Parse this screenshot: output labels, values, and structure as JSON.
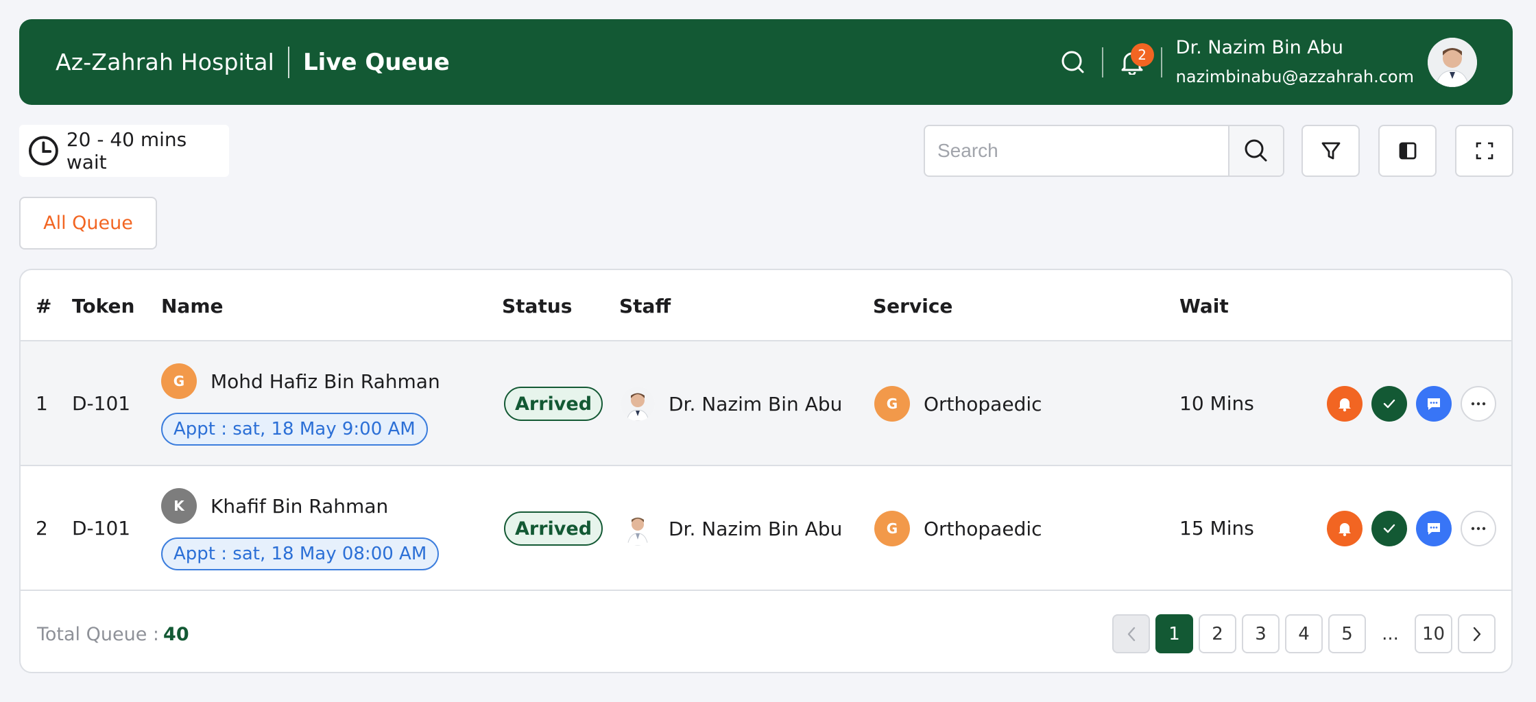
{
  "header": {
    "hospital": "Az-Zahrah Hospital",
    "title": "Live Queue",
    "notification_count": "2",
    "user_name": "Dr. Nazim Bin Abu",
    "user_email": "nazimbinabu@azzahrah.com"
  },
  "toolbar": {
    "wait_text": "20 - 40 mins wait",
    "search_placeholder": "Search",
    "tab_all": "All Queue"
  },
  "table": {
    "headers": [
      "#",
      "Token",
      "Name",
      "Status",
      "Staff",
      "Service",
      "Wait"
    ],
    "rows": [
      {
        "index": "1",
        "token": "D-101",
        "initial": "G",
        "name": "Mohd Hafiz Bin Rahman",
        "appt": "Appt : sat, 18 May 9:00 AM",
        "status": "Arrived",
        "staff": "Dr. Nazim Bin Abu",
        "service_initial": "G",
        "service": "Orthopaedic",
        "wait": "10 Mins"
      },
      {
        "index": "2",
        "token": "D-101",
        "initial": "K",
        "name": "Khafif Bin Rahman",
        "appt": "Appt : sat, 18 May 08:00 AM",
        "status": "Arrived",
        "staff": "Dr. Nazim Bin Abu",
        "service_initial": "G",
        "service": "Orthopaedic",
        "wait": "15 Mins"
      }
    ]
  },
  "footer": {
    "total_label": "Total Queue :",
    "total_value": "40",
    "pages": [
      "1",
      "2",
      "3",
      "4",
      "5",
      "...",
      "10"
    ]
  },
  "colors": {
    "brand": "#135934",
    "accent": "#f26522",
    "link": "#2b6fd6"
  }
}
